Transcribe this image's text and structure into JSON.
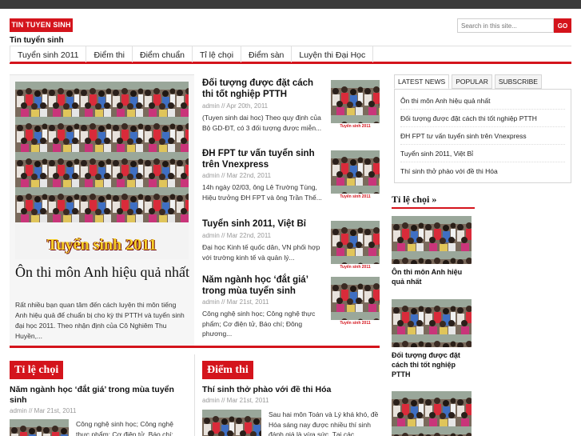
{
  "site": {
    "brand": "TIN TUYEN SINH",
    "tagline": "Tin tuyển sinh"
  },
  "search": {
    "placeholder": "Search in this site...",
    "button": "GO"
  },
  "nav": [
    "Tuyển sinh 2011",
    "Điểm thi",
    "Điểm chuẩn",
    "Tỉ lệ chọi",
    "Điểm sàn",
    "Luyện thi Đại Học"
  ],
  "featured": {
    "image_caption": "Tuyển sinh 2011",
    "title": "Ôn thi môn Anh hiệu quả nhất",
    "excerpt": "Rất nhiều bạn quan tâm đến cách luyện thi môn tiếng Anh hiệu quả để chuẩn bị cho kỳ thi PTTH và tuyển sinh đại học 2011. Theo nhận định của Cô Nghiêm Thu Huyền,..."
  },
  "posts": [
    {
      "title": "Đối tượng được đặt cách thi tốt nghiệp PTTH",
      "meta": "admin // Apr 20th, 2011",
      "excerpt": "(Tuyen sinh dai hoc) Theo quy định của Bộ GD-ĐT, có 3 đối tượng được miễn...",
      "thumb_caption": "Tuyển sinh 2011"
    },
    {
      "title": "ĐH FPT tư vấn tuyển sinh trên Vnexpress",
      "meta": "admin // Mar 22nd, 2011",
      "excerpt": "14h ngày 02/03, ông Lê Trường Tùng, Hiệu trưởng ĐH FPT và ông Trần Thế...",
      "thumb_caption": "Tuyển sinh 2011"
    },
    {
      "title": "Tuyển sinh 2011, Việt Bỉ",
      "meta": "admin // Mar 22nd, 2011",
      "excerpt": "Đại học Kinh tế quốc dân, VN phối hợp với trường kinh tế và quản lý...",
      "thumb_caption": "Tuyển sinh 2011"
    },
    {
      "title": "Năm ngành học ‘đắt giá’ trong mùa tuyển sinh",
      "meta": "admin // Mar 21st, 2011",
      "excerpt": "Công nghệ sinh học; Công nghệ thực phẩm; Cơ điện tử, Báo chí; Đông phương...",
      "thumb_caption": "Tuyển sinh 2011"
    }
  ],
  "sections": [
    {
      "heading": "Tỉ lệ chọi",
      "post_title": "Năm ngành học ‘đắt giá’ trong mùa tuyển sinh",
      "meta": "admin // Mar 21st, 2011",
      "excerpt": "Công nghệ sinh học; Công nghệ thực phẩm; Cơ điện tử, Báo chí;"
    },
    {
      "heading": "Điểm thi",
      "post_title": "Thí sinh thở phào với đề thi Hóa",
      "meta": "admin // Mar 21st, 2011",
      "excerpt": "Sau hai môn Toán và Lý khá khó, đề Hóa sáng nay được nhiều thí sinh đánh giá là vừa sức. Tại các"
    }
  ],
  "sidebar": {
    "tabs": [
      "LATEST NEWS",
      "POPULAR",
      "SUBSCRIBE"
    ],
    "latest": [
      "Ôn thi môn Anh hiệu quả nhất",
      "Đối tượng được đặt cách thi tốt nghiệp PTTH",
      "ĐH FPT tư vấn tuyển sinh trên Vnexpress",
      "Tuyển sinh 2011, Việt Bỉ",
      "Thí sinh thở phào với đề thi Hóa"
    ],
    "widget_title": "Tỉ lệ chọi »",
    "widget_posts": [
      "Ôn thi môn Anh hiệu quả nhất",
      "Đối tượng được đặt cách thi tốt nghiệp PTTH"
    ]
  },
  "colors": {
    "accent": "#d4141c",
    "topbar": "#3b3b3b"
  }
}
